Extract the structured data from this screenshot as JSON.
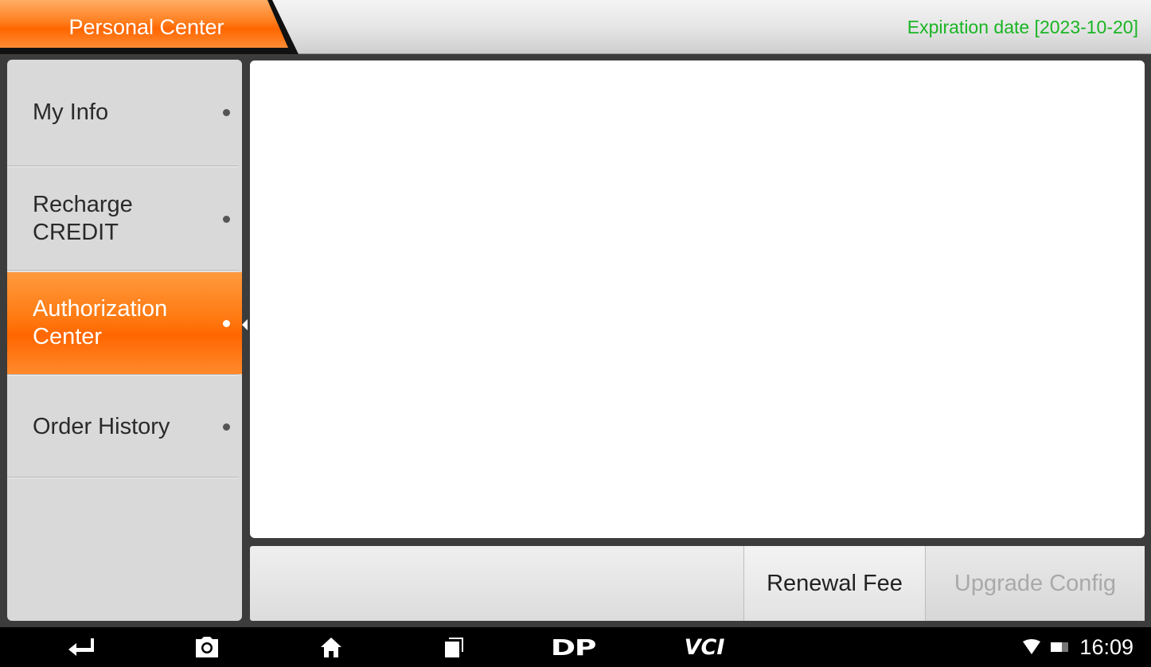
{
  "header": {
    "title": "Personal Center",
    "expiration": "Expiration date [2023-10-20]"
  },
  "sidebar": {
    "items": [
      {
        "label": "My Info",
        "active": false
      },
      {
        "label": "Recharge CREDIT",
        "active": false
      },
      {
        "label": "Authorization Center",
        "active": true
      },
      {
        "label": "Order History",
        "active": false
      }
    ]
  },
  "actions": {
    "renewal_label": "Renewal Fee",
    "upgrade_label": "Upgrade Config"
  },
  "navbar": {
    "icons": [
      "back-icon",
      "screenshot-icon",
      "home-icon",
      "recent-apps-icon",
      "dp-icon",
      "vci-icon"
    ],
    "dp_label": "DP",
    "vci_label": "VCI",
    "time": "16:09"
  },
  "colors": {
    "accent": "#ff6600",
    "expiry_green": "#19b523"
  }
}
